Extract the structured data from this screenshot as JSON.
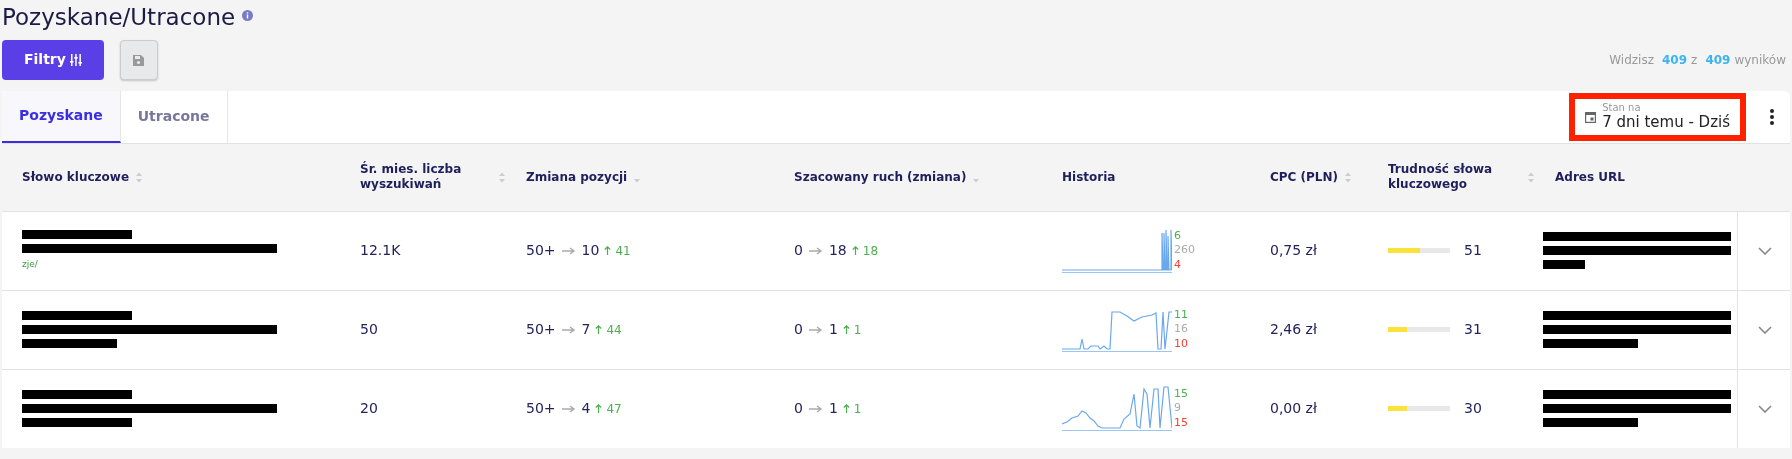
{
  "page": {
    "title": "Pozyskane/Utracone"
  },
  "toolbar": {
    "filter_button": "Filtry",
    "results": {
      "prefix": "Widzisz",
      "shown": "409",
      "sep": "z",
      "total": "409",
      "suffix": "wyników"
    }
  },
  "tabs": [
    {
      "label": "Pozyskane",
      "selected": true
    },
    {
      "label": "Utracone",
      "selected": false
    }
  ],
  "date_picker": {
    "label": "Stan na",
    "value": "7 dni temu - Dziś",
    "highlighted": true
  },
  "table": {
    "columns": [
      {
        "label": "Słowo kluczowe",
        "sort_up_arrow": true,
        "sort_down_arrow": true
      },
      {
        "label": "Śr. mies. liczba wyszukiwań",
        "sort_up_arrow": true,
        "sort_down_arrow": true
      },
      {
        "label": "Zmiana pozycji",
        "sort_up_arrow": false,
        "sort_down_arrow": true
      },
      {
        "label": "Szacowany ruch (zmiana)",
        "sort_up_arrow": false,
        "sort_down_arrow": true
      },
      {
        "label": "Historia",
        "sort_up_arrow": false,
        "sort_down_arrow": false
      },
      {
        "label": "CPC (PLN)",
        "sort_up_arrow": true,
        "sort_down_arrow": true
      },
      {
        "label": "Trudność słowa kluczowego",
        "sort_up_arrow": true,
        "sort_down_arrow": true
      },
      {
        "label": "Adres URL",
        "sort_up_arrow": false,
        "sort_down_arrow": false
      }
    ],
    "rows": [
      {
        "keyword_bars": [
          {
            "kind": "short"
          },
          {
            "kind": "long"
          }
        ],
        "keyword_note": "zje/",
        "searches": "12.1K",
        "pos_from": "50+",
        "pos_to": "10",
        "pos_delta": "41",
        "traffic_from": "0",
        "traffic_to": "18",
        "traffic_delta": "18",
        "history": {
          "up": "6",
          "same": "260",
          "down": "4"
        },
        "cpc": "0,75 zł",
        "difficulty": {
          "level": 0.51,
          "value": "51"
        },
        "url_bars": [
          {
            "kind": "long"
          },
          {
            "kind": "long"
          },
          {
            "kind": "tiny"
          }
        ]
      },
      {
        "keyword_bars": [
          {
            "kind": "short"
          },
          {
            "kind": "long"
          },
          {
            "kind": "mid"
          }
        ],
        "searches": "50",
        "pos_from": "50+",
        "pos_to": "7",
        "pos_delta": "44",
        "traffic_from": "0",
        "traffic_to": "1",
        "traffic_delta": "1",
        "history": {
          "up": "11",
          "same": "16",
          "down": "10"
        },
        "cpc": "2,46 zł",
        "difficulty": {
          "level": 0.31,
          "value": "31"
        },
        "url_bars": [
          {
            "kind": "long"
          },
          {
            "kind": "long"
          },
          {
            "kind": "mid"
          }
        ]
      },
      {
        "keyword_bars": [
          {
            "kind": "short"
          },
          {
            "kind": "long"
          },
          {
            "kind": "short"
          }
        ],
        "searches": "20",
        "pos_from": "50+",
        "pos_to": "4",
        "pos_delta": "47",
        "traffic_from": "0",
        "traffic_to": "1",
        "traffic_delta": "1",
        "history": {
          "up": "15",
          "same": "9",
          "down": "15"
        },
        "cpc": "0,00 zł",
        "difficulty": {
          "level": 0.3,
          "value": "30"
        },
        "url_bars": [
          {
            "kind": "long"
          },
          {
            "kind": "long"
          },
          {
            "kind": "mid"
          }
        ]
      }
    ]
  }
}
